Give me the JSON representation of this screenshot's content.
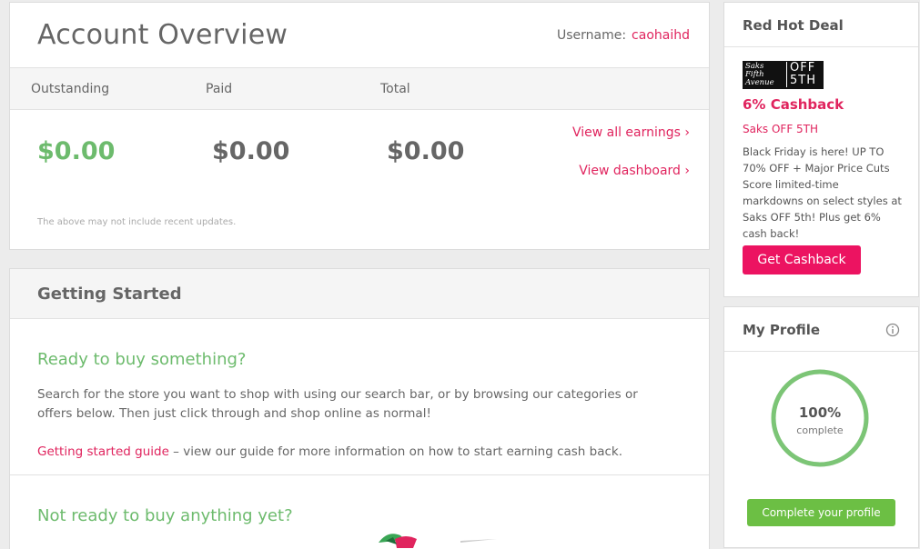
{
  "overview": {
    "title": "Account Overview",
    "username_label": "Username:",
    "username": "caohaihd",
    "columns": [
      "Outstanding",
      "Paid",
      "Total"
    ],
    "amounts": [
      "$0.00",
      "$0.00",
      "$0.00"
    ],
    "view_earnings": "View all earnings ›",
    "view_dashboard": "View dashboard ›",
    "note": "The above may not include recent updates."
  },
  "getting_started": {
    "title": "Getting Started",
    "ready_heading": "Ready to buy something?",
    "ready_text": "Search for the store you want to shop with using our search bar, or by browsing our categories or offers below. Then just click through and shop online as normal!",
    "guide_link": "Getting started guide",
    "guide_text": " – view our guide for more information on how to start earning cash back.",
    "not_ready_heading": "Not ready to buy anything yet?"
  },
  "deal": {
    "title": "Red Hot Deal",
    "logo_left": "Saks Fifth Avenue",
    "logo_right": "OFF 5TH",
    "cashback": "6% Cashback",
    "store": "Saks OFF 5TH",
    "description": "Black Friday is here! UP TO 70% OFF + Major Price Cuts Score limited-time markdowns on select styles at Saks OFF 5th! Plus get 6% cash back!",
    "button": "Get Cashback"
  },
  "profile": {
    "title": "My Profile",
    "percent": "100%",
    "percent_value": 100,
    "complete_label": "complete",
    "button": "Complete your profile"
  },
  "colors": {
    "accent_pink": "#e0245e",
    "green": "#6dbb6d",
    "button_pink": "#ec1361",
    "button_green": "#6cbf44"
  }
}
